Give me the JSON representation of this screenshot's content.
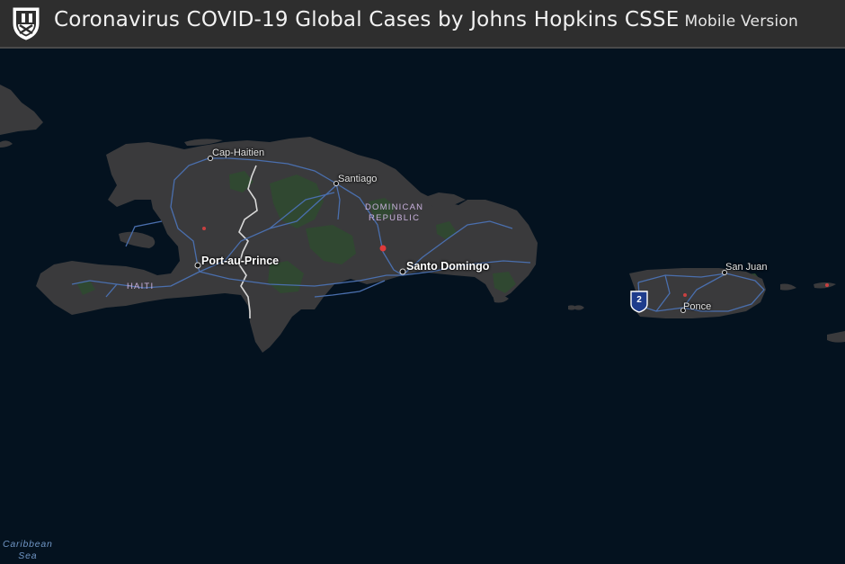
{
  "header": {
    "title": "Coronavirus COVID-19 Global Cases by Johns Hopkins CSSE",
    "subtitle": "Mobile Version",
    "logo_icon": "jhu-shield-icon"
  },
  "map": {
    "cities": {
      "cap_haitien": "Cap-Haitien",
      "santiago": "Santiago",
      "port_au_prince": "Port-au-Prince",
      "santo_domingo": "Santo Domingo",
      "san_juan": "San Juan",
      "ponce": "Ponce"
    },
    "countries": {
      "dominican_republic_line1": "DOMINICAN",
      "dominican_republic_line2": "REPUBLIC",
      "haiti": "HAITI"
    },
    "water": {
      "sea_line1": "Caribbean",
      "sea_line2": "Sea"
    },
    "highway_shield": "2",
    "colors": {
      "ocean": "#04121f",
      "land": "#3a3a3c",
      "vegetation": "#2f4a30",
      "roads": "#4a6fae",
      "case_dot": "#e03a3a",
      "header": "#2e2e2e"
    }
  }
}
